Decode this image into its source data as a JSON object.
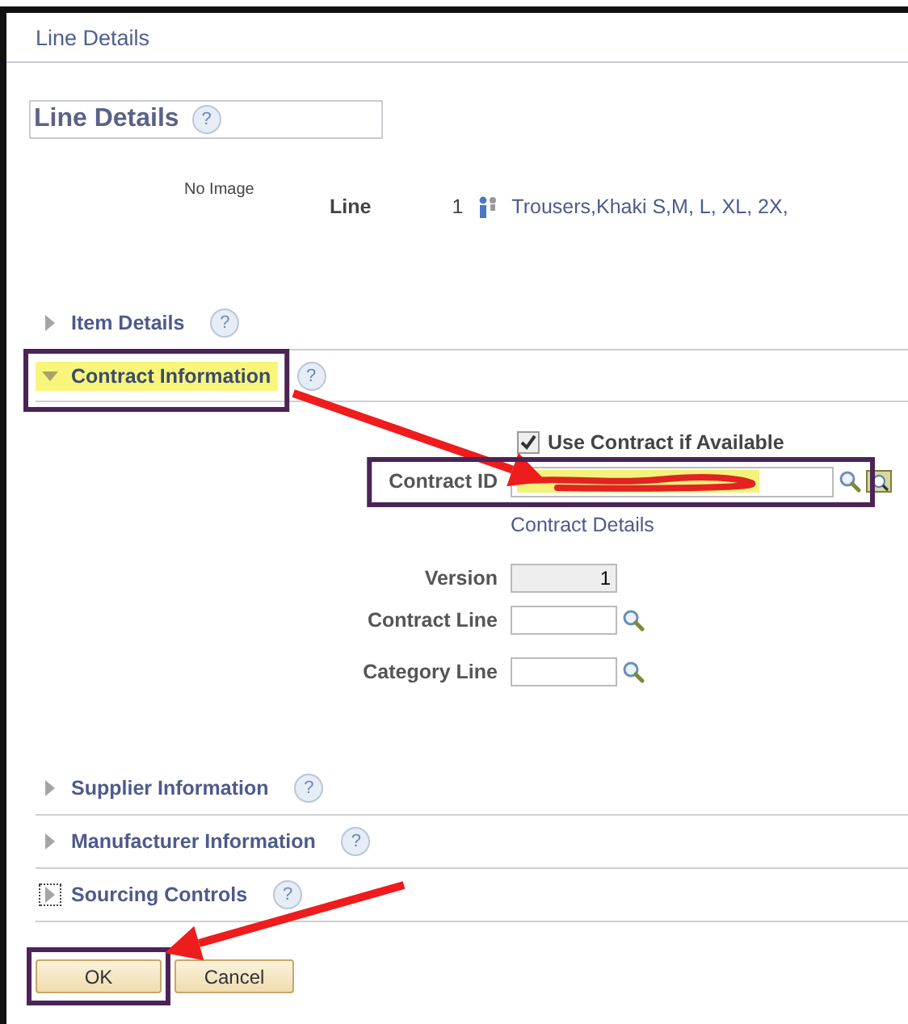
{
  "window": {
    "title": "Line Details"
  },
  "heading": {
    "text": "Line Details",
    "help": "?"
  },
  "line": {
    "image_text": "No Image",
    "label": "Line",
    "number": "1",
    "description": "Trousers,Khaki S,M, L, XL, 2X,"
  },
  "sections_top": [
    {
      "title": "Item Details",
      "expanded": false,
      "marked": false,
      "help": "?"
    },
    {
      "title": "Contract Information",
      "expanded": true,
      "marked": true,
      "help": "?"
    }
  ],
  "contract": {
    "use_contract": {
      "label": "Use Contract if Available",
      "checked": true
    },
    "contract_id": {
      "label": "Contract ID",
      "redacted": true,
      "marked": true
    },
    "details_link": "Contract Details",
    "fields": [
      {
        "label": "Version",
        "value": "1",
        "kind": "readonly"
      },
      {
        "label": "Contract Line",
        "kind": "lookup"
      },
      {
        "label": "Category Line",
        "kind": "lookup"
      }
    ]
  },
  "sections_bottom": [
    {
      "title": "Supplier Information",
      "expanded": false,
      "focused": false,
      "help": "?"
    },
    {
      "title": "Manufacturer Information",
      "expanded": false,
      "focused": false,
      "help": "?"
    },
    {
      "title": "Sourcing Controls",
      "expanded": false,
      "focused": true,
      "help": "?"
    }
  ],
  "buttons": [
    {
      "label": "OK",
      "marked": true
    },
    {
      "label": "Cancel",
      "marked": false
    }
  ]
}
